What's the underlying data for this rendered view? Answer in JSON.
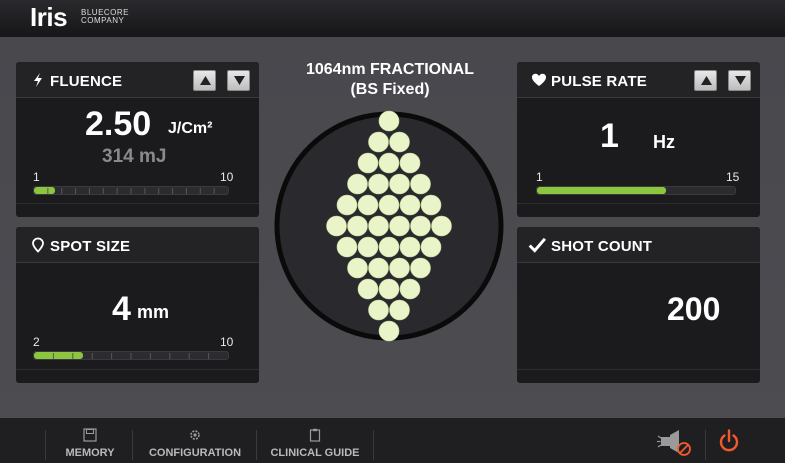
{
  "brand": {
    "name": "Iris",
    "sub_line1": "BLUECORE",
    "sub_line2": "COMPANY"
  },
  "fluence": {
    "title": "FLUENCE",
    "value": "2.50",
    "unit": "J/Cm²",
    "energy": "314 mJ",
    "scale_min": "1",
    "scale_max": "10",
    "level_fraction": 0.11
  },
  "spot_size": {
    "title": "SPOT SIZE",
    "value": "4",
    "unit": "mm",
    "scale_min": "2",
    "scale_max": "10",
    "level_fraction": 0.25
  },
  "center": {
    "title_line1": "1064nm FRACTIONAL",
    "title_line2": "(BS Fixed)"
  },
  "pulse_rate": {
    "title": "PULSE RATE",
    "value": "1",
    "unit": "Hz",
    "scale_min": "1",
    "scale_max": "15",
    "level_fraction": 0.65
  },
  "shot_count": {
    "title": "SHOT COUNT",
    "value": "200"
  },
  "footer": {
    "memory_label": "MEMORY",
    "configuration_label": "CONFIGURATION",
    "clinical_guide_label": "CLINICAL GUIDE"
  },
  "colors": {
    "accent_green": "#8cc63e",
    "spot_color": "#e9f5c8",
    "power_orange": "#f25a2c"
  },
  "icons": [
    "lightning-icon",
    "pin-icon",
    "heart-icon",
    "check-icon",
    "floppy-disk-icon",
    "gear-icon",
    "clipboard-icon",
    "aim-disabled-icon",
    "power-icon"
  ]
}
